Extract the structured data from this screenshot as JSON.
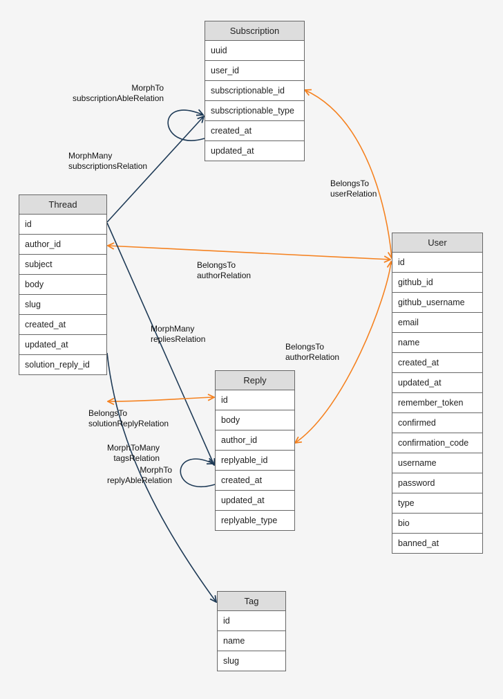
{
  "entities": {
    "subscription": {
      "title": "Subscription",
      "fields": [
        "uuid",
        "user_id",
        "subscriptionable_id",
        "subscriptionable_type",
        "created_at",
        "updated_at"
      ]
    },
    "thread": {
      "title": "Thread",
      "fields": [
        "id",
        "author_id",
        "subject",
        "body",
        "slug",
        "created_at",
        "updated_at",
        "solution_reply_id"
      ]
    },
    "reply": {
      "title": "Reply",
      "fields": [
        "id",
        "body",
        "author_id",
        "replyable_id",
        "created_at",
        "updated_at",
        "replyable_type"
      ]
    },
    "user": {
      "title": "User",
      "fields": [
        "id",
        "github_id",
        "github_username",
        "email",
        "name",
        "created_at",
        "updated_at",
        "remember_token",
        "confirmed",
        "confirmation_code",
        "username",
        "password",
        "type",
        "bio",
        "banned_at"
      ]
    },
    "tag": {
      "title": "Tag",
      "fields": [
        "id",
        "name",
        "slug"
      ]
    }
  },
  "relations": {
    "morphto_subscriptionable": {
      "l1": "MorphTo",
      "l2": "subscriptionAbleRelation"
    },
    "morphmany_subscriptions": {
      "l1": "MorphMany",
      "l2": "subscriptionsRelation"
    },
    "belongsto_user": {
      "l1": "BelongsTo",
      "l2": "userRelation"
    },
    "belongsto_author_thread": {
      "l1": "BelongsTo",
      "l2": "authorRelation"
    },
    "morphmany_replies": {
      "l1": "MorphMany",
      "l2": "repliesRelation"
    },
    "belongsto_author_reply": {
      "l1": "BelongsTo",
      "l2": "authorRelation"
    },
    "belongsto_solution": {
      "l1": "BelongsTo",
      "l2": "solutionReplyRelation"
    },
    "morphtomany_tags": {
      "l1": "MorphToMany",
      "l2": "tagsRelation"
    },
    "morphto_replyable": {
      "l1": "MorphTo",
      "l2": "replyAbleRelation"
    }
  },
  "colors": {
    "navy": "#1f3b57",
    "orange": "#f58220"
  }
}
